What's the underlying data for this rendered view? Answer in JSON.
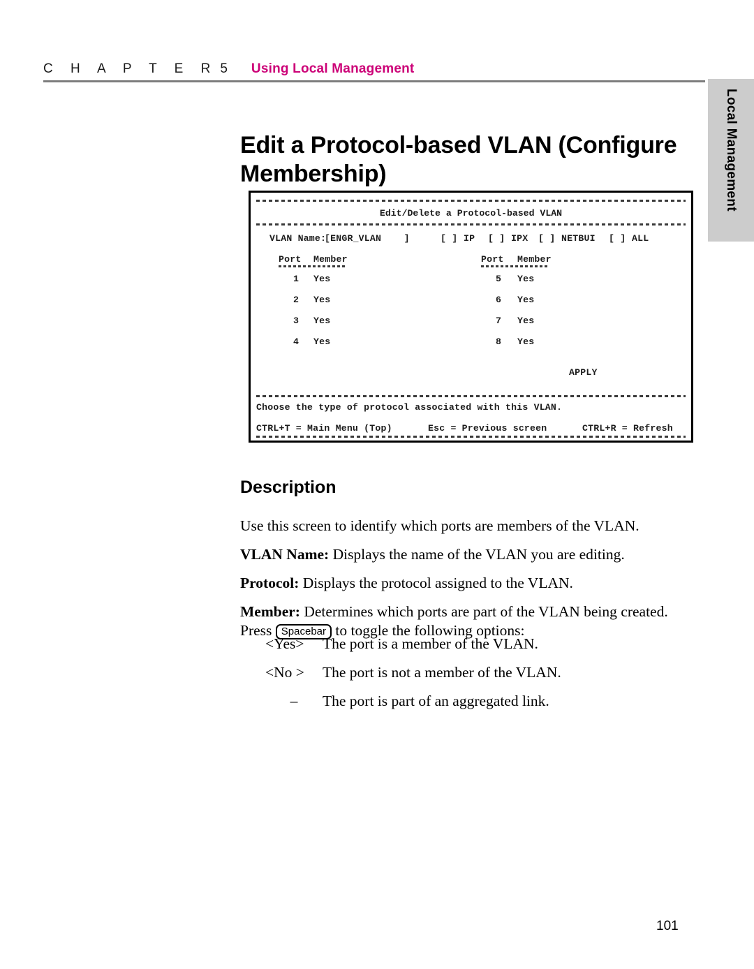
{
  "header": {
    "chapter_letters": "C H A P T E R",
    "chapter_number": "5",
    "chapter_title": "Using Local Management"
  },
  "side_tab": {
    "label": "Local Management"
  },
  "page_title": "Edit a Protocol-based VLAN (Configure Membership)",
  "terminal": {
    "screen_title": "Edit/Delete a Protocol-based VLAN",
    "vlan_name_label": "VLAN Name:",
    "vlan_name_field": "[ENGR_VLAN    ]",
    "protocols": [
      {
        "box": "[ ]",
        "label": "IP"
      },
      {
        "box": "[ ]",
        "label": "IPX"
      },
      {
        "box": "[ ]",
        "label": "NETBUI"
      },
      {
        "box": "[ ]",
        "label": "ALL"
      }
    ],
    "table": {
      "col_port_header": "Port",
      "col_member_header": "Member",
      "left_rows": [
        {
          "port": "1",
          "member": "Yes"
        },
        {
          "port": "2",
          "member": "Yes"
        },
        {
          "port": "3",
          "member": "Yes"
        },
        {
          "port": "4",
          "member": "Yes"
        }
      ],
      "right_rows": [
        {
          "port": "5",
          "member": "Yes"
        },
        {
          "port": "6",
          "member": "Yes"
        },
        {
          "port": "7",
          "member": "Yes"
        },
        {
          "port": "8",
          "member": "Yes"
        }
      ]
    },
    "apply_label": "APPLY",
    "status_line": "Choose the type of protocol associated with this VLAN.",
    "key_hints": [
      "CTRL+T = Main Menu (Top)",
      "Esc = Previous screen",
      "CTRL+R = Refresh"
    ]
  },
  "description": {
    "heading": "Description",
    "intro": "Use this screen to identify which ports are members of the VLAN.",
    "vlan_name_term": "VLAN Name:",
    "vlan_name_text": " Displays the name of the VLAN you are editing.",
    "protocol_term": "Protocol:",
    "protocol_text": " Displays the protocol assigned to the VLAN.",
    "member_term": "Member:",
    "member_text": " Determines which ports are part of the VLAN being created.",
    "press_prefix": "Press ",
    "spacebar_key": "Spacebar",
    "press_suffix": " to toggle the following options:",
    "options": [
      {
        "key": "<Yes>",
        "text": "The port is a member of the VLAN."
      },
      {
        "key": "<No >",
        "text": "The port is not a member of the VLAN."
      },
      {
        "key": "–",
        "text": "The port is part of an aggregated link."
      }
    ]
  },
  "footer": {
    "page_number": "101"
  },
  "colors": {
    "accent": "#cc0077",
    "rule": "#7d7d7d",
    "tab_bg": "#cccccc"
  }
}
